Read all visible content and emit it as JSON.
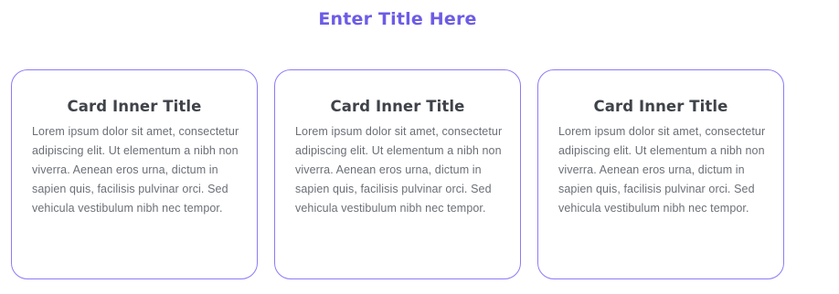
{
  "page": {
    "title": "Enter Title Here",
    "accent_color": "#6c5ce7"
  },
  "cards": [
    {
      "title": "Card Inner Title",
      "body": "Lorem ipsum dolor sit amet, consectetur adipiscing elit. Ut elementum a nibh non viverra. Aenean eros urna, dictum in sapien quis, facilisis pulvinar orci. Sed vehicula vestibulum nibh nec tempor."
    },
    {
      "title": "Card Inner Title",
      "body": "Lorem ipsum dolor sit amet, consectetur adipiscing elit. Ut elementum a nibh non viverra. Aenean eros urna, dictum in sapien quis, facilisis pulvinar orci. Sed vehicula vestibulum nibh nec tempor."
    },
    {
      "title": "Card Inner Title",
      "body": "Lorem ipsum dolor sit amet, consectetur adipiscing elit. Ut elementum a nibh non viverra. Aenean eros urna, dictum in sapien quis, facilisis pulvinar orci. Sed vehicula vestibulum nibh nec tempor."
    }
  ]
}
